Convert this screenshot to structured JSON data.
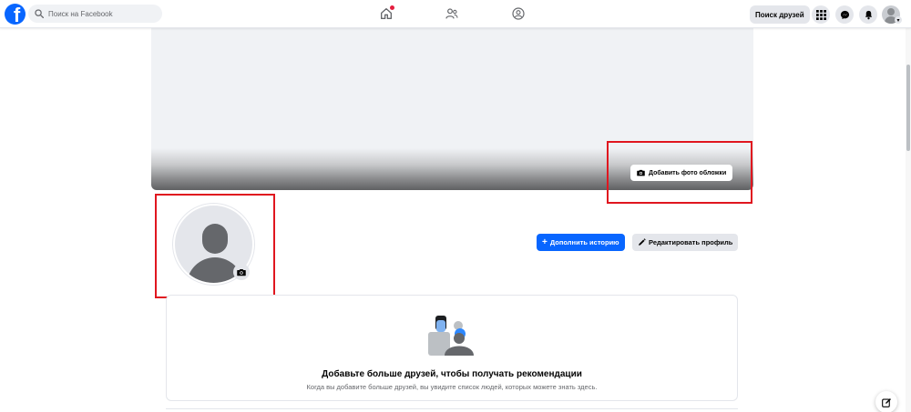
{
  "topbar": {
    "logo_letter": "f",
    "search_placeholder": "Поиск на Facebook",
    "find_friends_label": "Поиск друзей",
    "icons": [
      "home-icon",
      "friends-icon",
      "groups-icon",
      "menu-grid-icon",
      "messenger-icon",
      "bell-icon",
      "account-avatar"
    ]
  },
  "cover": {
    "add_cover_label": "Добавить фото обложки"
  },
  "profile": {
    "add_story_label": "Дополнить историю",
    "add_story_plus": "+",
    "edit_profile_label": "Редактировать профиль"
  },
  "recommendations": {
    "title": "Добавьте больше друзей, чтобы получать рекомендации",
    "subtitle": "Когда вы добавите больше друзей, вы увидите список людей, которых можете знать здесь."
  },
  "colors": {
    "brand": "#0866ff",
    "highlight": "#e0161f",
    "notification_dot": "#e41e3f"
  }
}
